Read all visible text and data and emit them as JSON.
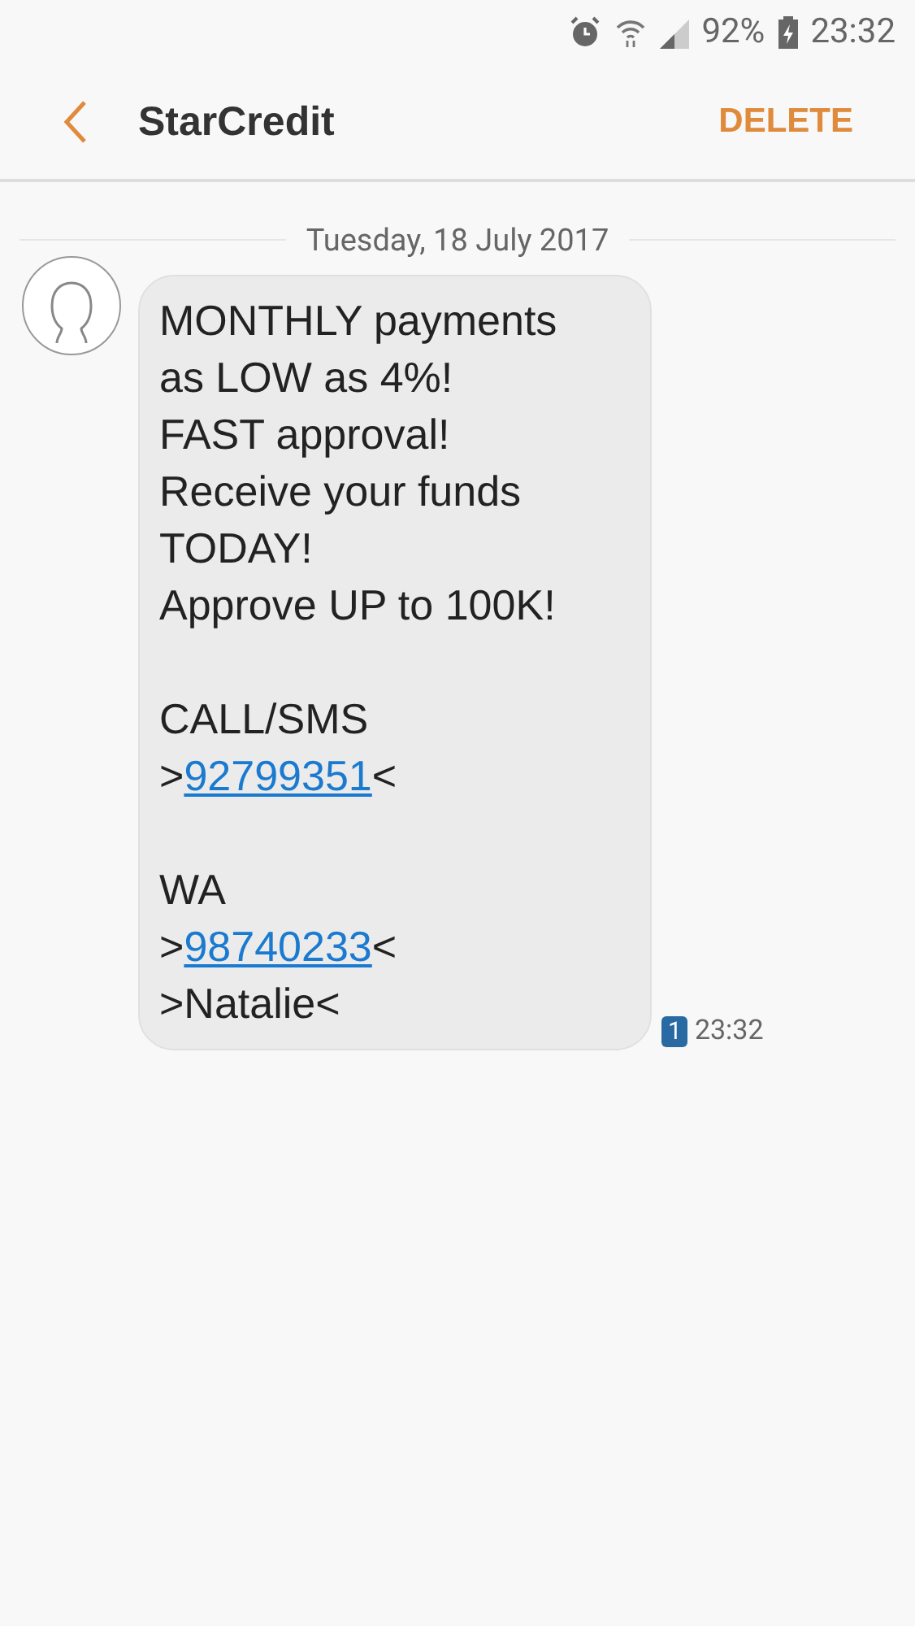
{
  "status_bar": {
    "battery": "92%",
    "time": "23:32"
  },
  "header": {
    "title": "StarCredit",
    "action": "DELETE"
  },
  "date_divider": "Tuesday, 18 July 2017",
  "message": {
    "paragraphs": [
      {
        "lines": [
          {
            "kind": "text",
            "text": "MONTHLY payments"
          },
          {
            "kind": "text",
            "text": "as LOW as 4%!"
          },
          {
            "kind": "text",
            "text": "FAST approval!"
          },
          {
            "kind": "text",
            "text": "Receive your funds"
          },
          {
            "kind": "text",
            "text": "TODAY!"
          },
          {
            "kind": "text",
            "text": "Approve UP to 100K!"
          }
        ]
      },
      {
        "lines": [
          {
            "kind": "text",
            "text": "CALL/SMS"
          },
          {
            "kind": "link",
            "prefix": ">",
            "link": "92799351",
            "suffix": "<"
          }
        ]
      },
      {
        "lines": [
          {
            "kind": "text",
            "text": "WA"
          },
          {
            "kind": "link",
            "prefix": ">",
            "link": "98740233",
            "suffix": "<"
          },
          {
            "kind": "text",
            "text": ">Natalie<"
          }
        ]
      }
    ],
    "sim": "1",
    "time": "23:32"
  }
}
